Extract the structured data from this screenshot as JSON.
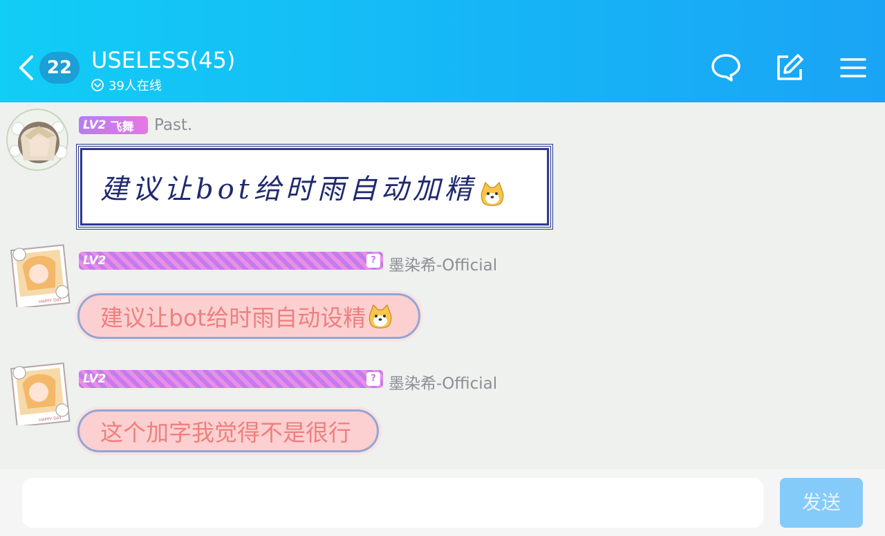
{
  "header": {
    "unread_count": "22",
    "title": "USELESS(45)",
    "online_status": "39人在线"
  },
  "messages": [
    {
      "level": "LV2",
      "title_badge": "飞舞",
      "username": "Past.",
      "text": "建议让bot给时雨自动加精"
    },
    {
      "level": "LV2",
      "username": "墨染希-Official",
      "text": "建议让bot给时雨自动设精"
    },
    {
      "level": "LV2",
      "username": "墨染希-Official",
      "text": "这个加字我觉得不是很行"
    }
  ],
  "composer": {
    "input_value": "",
    "send_label": "发送"
  },
  "colors": {
    "header_start": "#12cdf6",
    "header_end": "#1aa4f5",
    "level_badge": "#c77dff",
    "bubble_pink": "#fcd0d0",
    "bubble_text_pink": "#ef7f7f",
    "navy_text": "#20296f",
    "send_button": "#84cbfa"
  }
}
